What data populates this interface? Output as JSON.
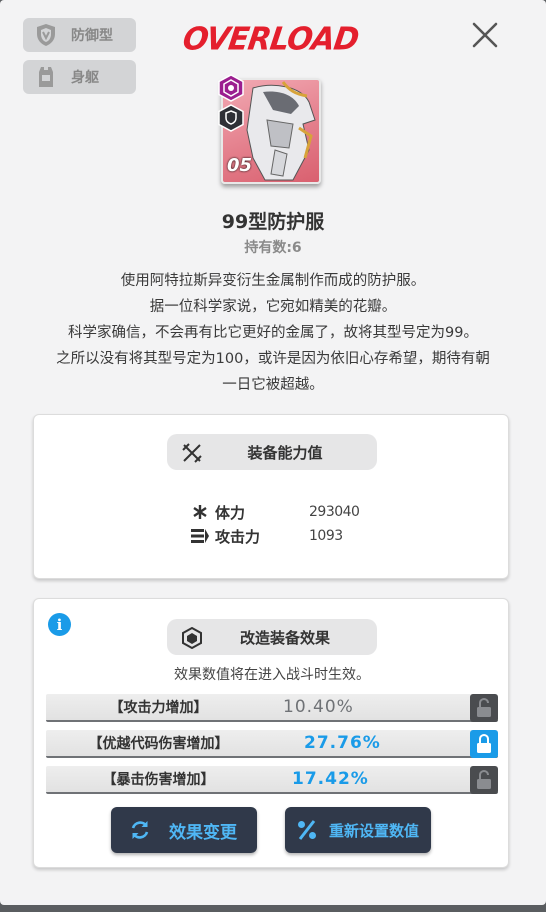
{
  "header": {
    "tags": [
      {
        "label": "防御型",
        "icon": "shield-icon"
      },
      {
        "label": "身躯",
        "icon": "body-armor-icon"
      }
    ],
    "logo": "OVERLOAD",
    "close_icon": "close-icon"
  },
  "item": {
    "card_number": "05",
    "name": "99型防护服",
    "owned": "持有数:6",
    "description": [
      "使用阿特拉斯异变衍生金属制作而成的防护服。",
      "据一位科学家说，它宛如精美的花瓣。",
      "科学家确信，不会再有比它更好的金属了，故将其型号定为99。",
      "之所以没有将其型号定为100，或许是因为依旧心存希望，期待有朝",
      "一日它被超越。"
    ]
  },
  "equip_stats": {
    "title": "装备能力值",
    "stats": [
      {
        "label": "体力",
        "value": "293040",
        "icon": "asterisk-icon"
      },
      {
        "label": "攻击力",
        "value": "1093",
        "icon": "attack-bars-icon"
      }
    ]
  },
  "overload_effects": {
    "title": "改造装备效果",
    "note": "效果数值将在进入战斗时生效。",
    "effects": [
      {
        "label": "【攻击力增加】",
        "value": "10.40%",
        "locked": false
      },
      {
        "label": "【优越代码伤害增加】",
        "value": "27.76%",
        "locked": true
      },
      {
        "label": "【暴击伤害增加】",
        "value": "17.42%",
        "locked": false
      }
    ],
    "buttons": {
      "change": "效果变更",
      "reset": "重新设置数值"
    }
  },
  "colors": {
    "accent_blue": "#1a9be8",
    "logo_red": "#e41f2d",
    "button_bg": "#30394a"
  }
}
